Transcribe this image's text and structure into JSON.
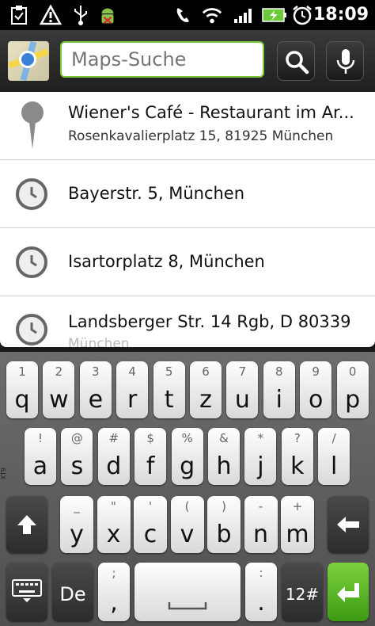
{
  "status": {
    "time": "18:09"
  },
  "search": {
    "placeholder": "Maps-Suche"
  },
  "results": [
    {
      "title": "Wiener's Café - Restaurant im Ar...",
      "subtitle": "Rosenkavalierplatz 15, 81925 München",
      "icon": "map-pin-icon"
    },
    {
      "title": "Bayerstr. 5, München",
      "icon": "history-clock-icon"
    },
    {
      "title": "Isartorplatz 8, München",
      "icon": "history-clock-icon"
    },
    {
      "title": "Landsberger Str. 14 Rgb, D 80339",
      "subtitle": "München",
      "icon": "history-clock-icon"
    }
  ],
  "keyboard": {
    "row1": [
      {
        "alt": "1",
        "key": "q"
      },
      {
        "alt": "2",
        "key": "w"
      },
      {
        "alt": "3",
        "key": "e"
      },
      {
        "alt": "4",
        "key": "r"
      },
      {
        "alt": "5",
        "key": "t"
      },
      {
        "alt": "6",
        "key": "z"
      },
      {
        "alt": "7",
        "key": "u"
      },
      {
        "alt": "8",
        "key": "i"
      },
      {
        "alt": "9",
        "key": "o"
      },
      {
        "alt": "0",
        "key": "p"
      }
    ],
    "row2": [
      {
        "alt": "!",
        "key": "a"
      },
      {
        "alt": "@",
        "key": "s"
      },
      {
        "alt": "#",
        "key": "d"
      },
      {
        "alt": "$",
        "key": "f"
      },
      {
        "alt": "%",
        "key": "g"
      },
      {
        "alt": "&",
        "key": "h"
      },
      {
        "alt": "*",
        "key": "j"
      },
      {
        "alt": "?",
        "key": "k"
      },
      {
        "alt": "/",
        "key": "l"
      }
    ],
    "row3": [
      {
        "alt": "_",
        "key": "y"
      },
      {
        "alt": "\"",
        "key": "x"
      },
      {
        "alt": "'",
        "key": "c"
      },
      {
        "alt": "(",
        "key": "v"
      },
      {
        "alt": ")",
        "key": "b"
      },
      {
        "alt": "-",
        "key": "n"
      },
      {
        "alt": "+",
        "key": "m"
      }
    ],
    "row4": {
      "lang": "De",
      "punct_top": ";",
      "punct_bottom": ",",
      "colon_top": ":",
      "colon_bottom": ".",
      "sym": "12#"
    },
    "side_label": "XT9"
  }
}
